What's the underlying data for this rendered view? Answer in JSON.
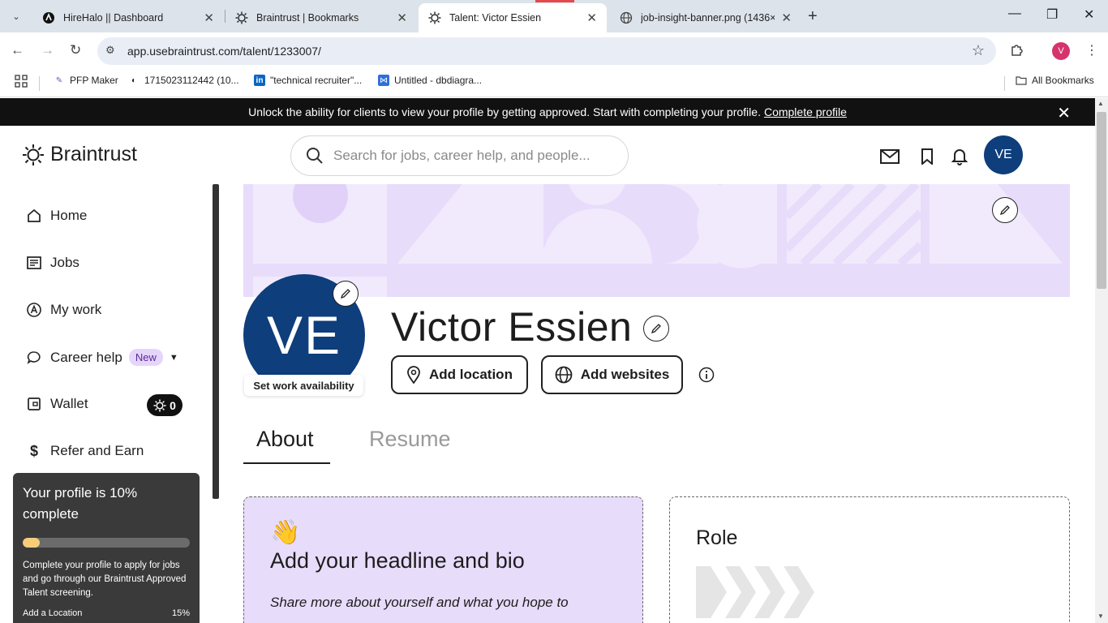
{
  "browser": {
    "tabs": [
      {
        "title": "HireHalo || Dashboard",
        "active": false
      },
      {
        "title": "Braintrust | Bookmarks",
        "active": false
      },
      {
        "title": "Talent: Victor Essien",
        "active": true
      },
      {
        "title": "job-insight-banner.png (1436×",
        "active": false
      }
    ],
    "url": "app.usebraintrust.com/talent/1233007/",
    "profile_initial": "V",
    "bookmarks": [
      {
        "label": "PFP Maker"
      },
      {
        "label": "1715023112442 (10..."
      },
      {
        "label": "\"technical recruiter\"..."
      },
      {
        "label": "Untitled - dbdiagra..."
      }
    ],
    "all_bookmarks": "All Bookmarks"
  },
  "banner": {
    "text": "Unlock the ability for clients to view your profile by getting approved. Start with completing your profile.",
    "link": "Complete profile"
  },
  "header": {
    "logo": "Braintrust",
    "search_placeholder": "Search for jobs, career help, and people...",
    "avatar_initials": "VE"
  },
  "sidebar": {
    "items": [
      {
        "label": "Home",
        "icon": "home-icon"
      },
      {
        "label": "Jobs",
        "icon": "jobs-icon"
      },
      {
        "label": "My work",
        "icon": "my-work-icon"
      },
      {
        "label": "Career help",
        "icon": "chat-icon",
        "badge": "New"
      },
      {
        "label": "Wallet",
        "icon": "wallet-icon",
        "balance": "0"
      },
      {
        "label": "Refer and Earn",
        "icon": "dollar-icon"
      }
    ],
    "progress": {
      "title": "Your profile is 10% complete",
      "percent": 10,
      "description": "Complete your profile to apply for jobs and go through our Braintrust Approved Talent screening.",
      "next_item": "Add a Location",
      "next_value": "15%"
    }
  },
  "profile": {
    "initials": "VE",
    "availability": "Set work availability",
    "name": "Victor Essien",
    "add_location": "Add location",
    "add_websites": "Add websites",
    "tabs": [
      {
        "label": "About",
        "active": true
      },
      {
        "label": "Resume",
        "active": false
      }
    ],
    "bio_card": {
      "emoji": "👋",
      "title": "Add your headline and bio",
      "subtitle": "Share more about yourself and what you hope to"
    },
    "role_card": {
      "title": "Role"
    }
  },
  "colors": {
    "accent_purple": "#e8dcfb",
    "avatar_blue": "#0e3e7b",
    "progress_fill": "#f7cd7a",
    "banner_bg": "#111111"
  }
}
